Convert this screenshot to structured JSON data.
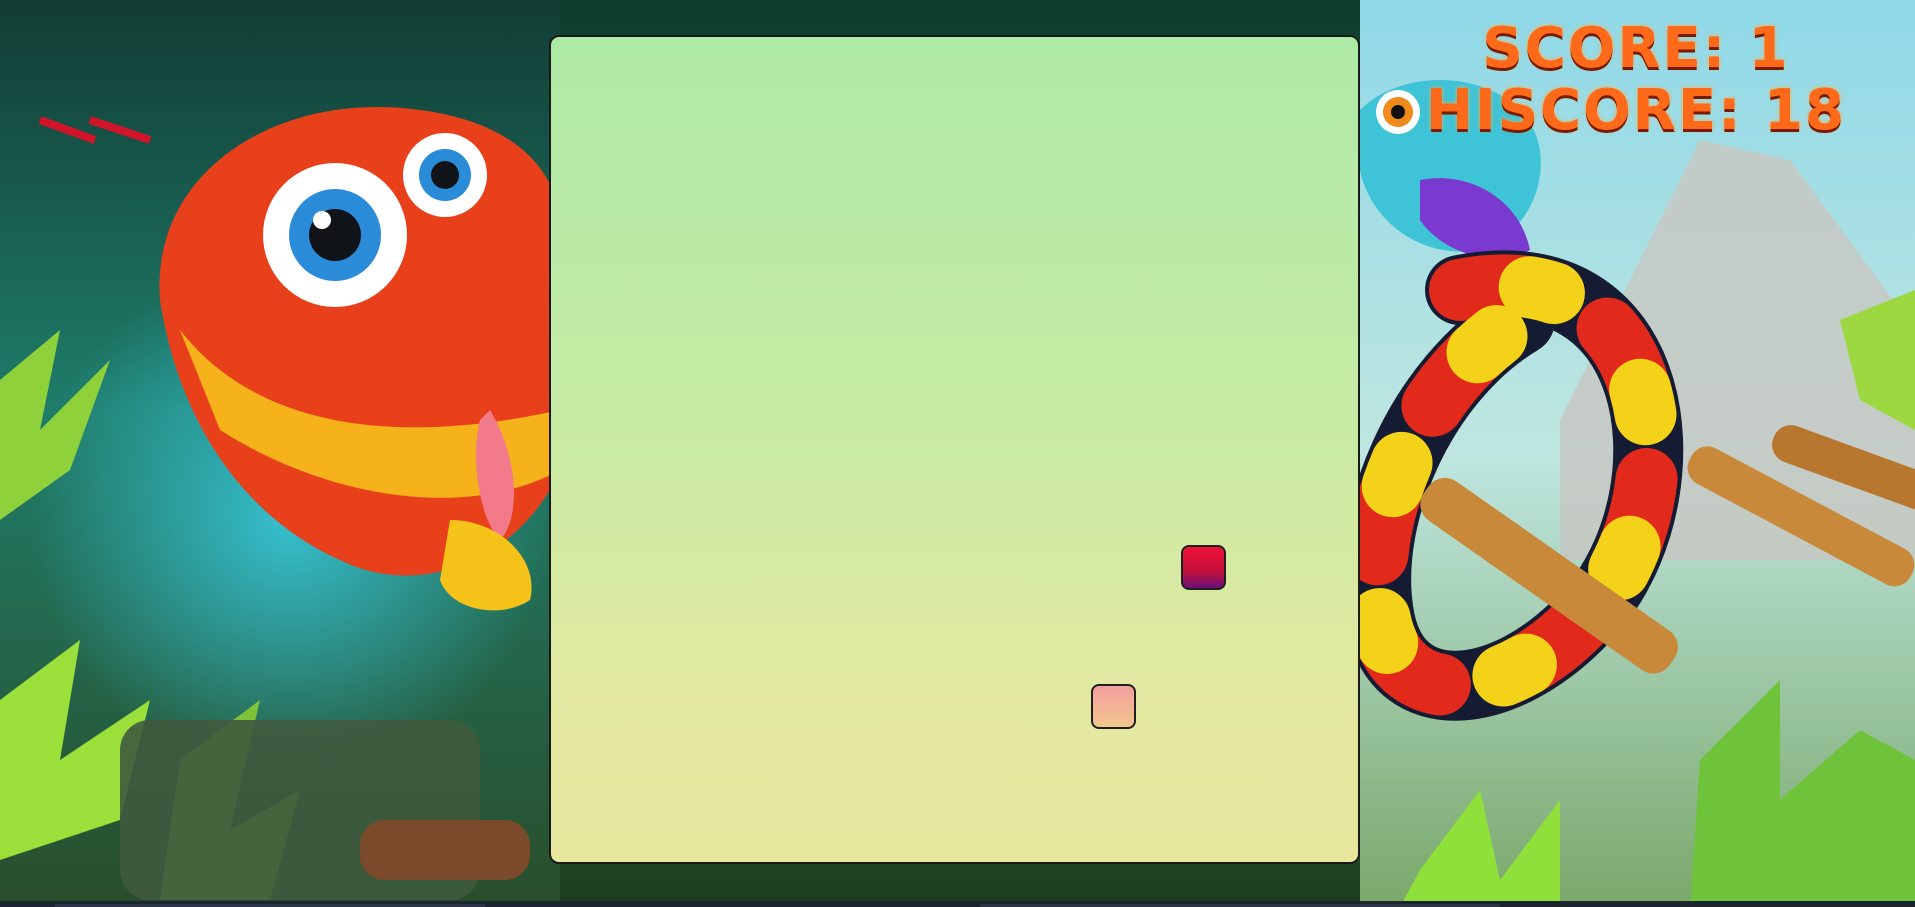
{
  "game": {
    "score_label": "SCORE:",
    "score_value": "1",
    "hiscore_label": "HISCORE:",
    "hiscore_value": "18"
  },
  "colors": {
    "board_top": "#aeeaa6",
    "board_bottom": "#e8e79e",
    "food": "#e8103a",
    "snake_head": "#f3b394",
    "score_text": "#ff6a1a"
  },
  "icons": {
    "food": "food-cell-icon",
    "snake": "snake-head-icon",
    "mascot_left": "red-snake-mascot",
    "mascot_right": "coral-snake-mascot"
  }
}
